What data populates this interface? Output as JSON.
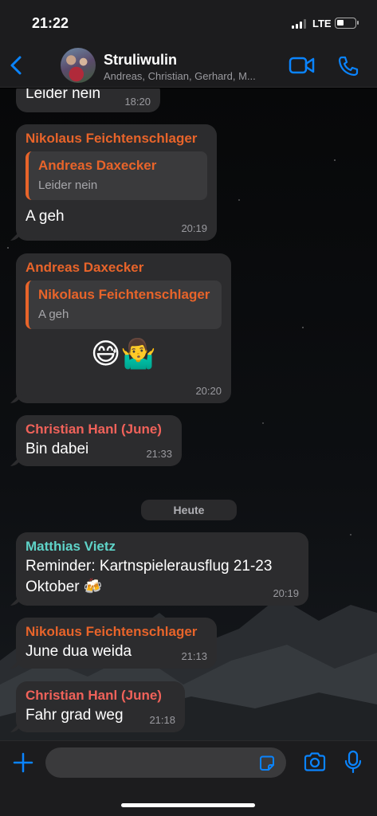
{
  "status": {
    "time": "21:22",
    "network": "LTE"
  },
  "header": {
    "title": "Struliwulin",
    "subtitle": "Andreas, Christian, Gerhard, M..."
  },
  "colors": {
    "accent": "#0a84ff",
    "orange_sender": "#e8642a",
    "red_sender": "#f0625a",
    "teal_sender": "#5fd3c8",
    "bubble": "#2c2c2e"
  },
  "messages": [
    {
      "text": "Leider nein",
      "time": "18:20"
    },
    {
      "sender": "Nikolaus Feichtenschlager",
      "quote_sender": "Andreas Daxecker",
      "quote_text": "Leider nein",
      "text": "A geh",
      "time": "20:19"
    },
    {
      "sender": "Andreas Daxecker",
      "quote_sender": "Nikolaus Feichtenschlager",
      "quote_text": "A geh",
      "text": "😅🤷‍♂️",
      "time": "20:20"
    },
    {
      "sender": "Christian Hanl (June)",
      "text": "Bin dabei",
      "time": "21:33"
    },
    {
      "sender": "Matthias Vietz",
      "text": "Reminder: Kartnspielerausflug 21-23 Oktober 🍻",
      "time": "20:19"
    },
    {
      "sender": "Nikolaus Feichtenschlager",
      "text": "June dua weida",
      "time": "21:13"
    },
    {
      "sender": "Christian Hanl (June)",
      "text": "Fahr grad weg",
      "time": "21:18"
    }
  ],
  "day_separator": "Heute",
  "input": {
    "value": "",
    "placeholder": ""
  },
  "icons": [
    "back-icon",
    "video-call-icon",
    "phone-icon",
    "plus-icon",
    "sticker-icon",
    "camera-icon",
    "microphone-icon"
  ]
}
